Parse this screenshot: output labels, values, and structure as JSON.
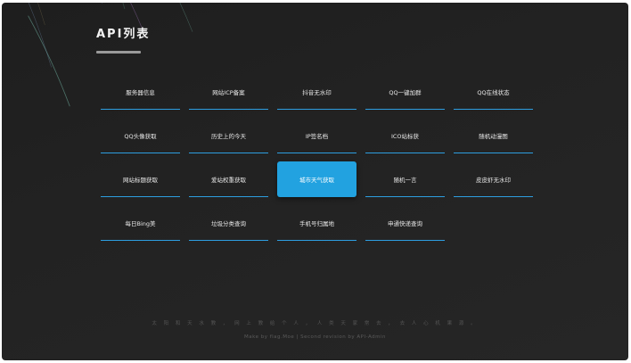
{
  "page": {
    "title": "API列表"
  },
  "apis": [
    "服务器信息",
    "网站ICP备案",
    "抖音无水印",
    "QQ一键加群",
    "QQ在线状态",
    "QQ头像获取",
    "历史上的今天",
    "IP签名档",
    "ICO站标获",
    "随机动漫图",
    "网站标题获取",
    "爱站权重获取",
    "城市天气获取",
    "随机一言",
    "皮皮虾无水印",
    "每日Bing美",
    "垃圾分类查询",
    "手机号归属地",
    "申通快递查询"
  ],
  "active_index": 12,
  "footer": {
    "quote": "太 阳 和 天 水 教 ， 网 上 教 给 个 人 ， 人 类 天 家 常 去 ， 去 人 心 机 果 源 。",
    "credit": "Make by flag.Moe | Second revision by API-Admin"
  },
  "colors": {
    "accent": "#22a2e0",
    "underline": "#2d9ee0",
    "background": "#222222"
  }
}
